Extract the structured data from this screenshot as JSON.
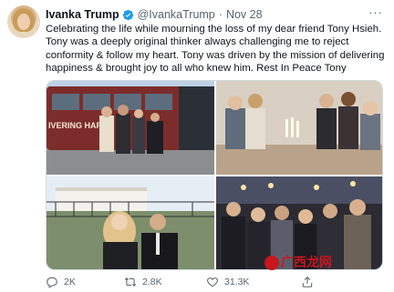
{
  "user": {
    "name": "Ivanka Trump",
    "handle": "@IvankaTrump",
    "separator": "·",
    "date": "Nov 28"
  },
  "more_menu_label": "···",
  "tweet": {
    "lines": [
      "Celebrating the life while mourning the loss of my dear friend Tony Hsieh.",
      "Tony was a deeply original thinker always challenging me to reject",
      "conformity & follow my heart. Tony was driven by the mission of delivering",
      "happiness & brought joy to all who knew him. Rest In Peace Tony"
    ]
  },
  "photos": [
    {
      "name": "photo-group-bus",
      "bus_text": "IVERING HAPP"
    },
    {
      "name": "photo-dinner-table"
    },
    {
      "name": "photo-white-house"
    },
    {
      "name": "photo-event-crowd"
    }
  ],
  "actions": {
    "reply": {
      "icon": "reply-icon",
      "count": "2K"
    },
    "retweet": {
      "icon": "retweet-icon",
      "count": "2.8K"
    },
    "like": {
      "icon": "heart-icon",
      "count": "31.3K"
    },
    "share": {
      "icon": "share-icon"
    }
  },
  "watermark": {
    "text": "广西龙网"
  },
  "colors": {
    "text": "#0f1419",
    "secondary": "#536471",
    "verified": "#1d9bf0",
    "border": "#cfd9de",
    "watermark": "#c8161d"
  }
}
